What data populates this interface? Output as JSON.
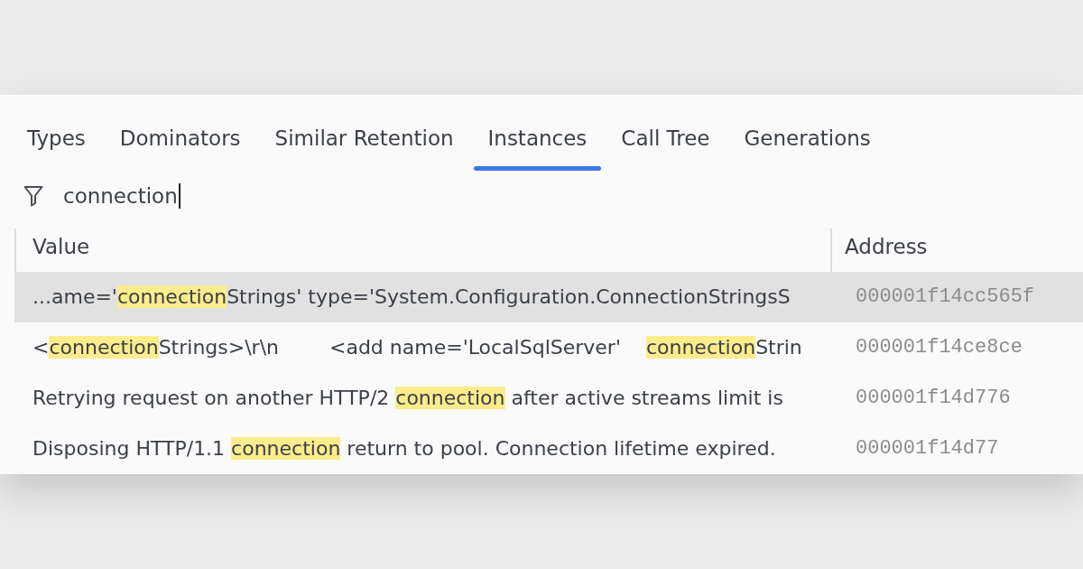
{
  "tabs": [
    {
      "label": "Types",
      "selected": false
    },
    {
      "label": "Dominators",
      "selected": false
    },
    {
      "label": "Similar Retention",
      "selected": false
    },
    {
      "label": "Instances",
      "selected": true
    },
    {
      "label": "Call Tree",
      "selected": false
    },
    {
      "label": "Generations",
      "selected": false
    }
  ],
  "filter": {
    "value": "connection"
  },
  "table": {
    "columns": [
      {
        "label": "Value"
      },
      {
        "label": "Address"
      }
    ],
    "rows": [
      {
        "selected": true,
        "value": [
          {
            "text": "...ame='",
            "kind": "plain"
          },
          {
            "text": "connection",
            "kind": "match"
          },
          {
            "text": "Strings' type='System.Configuration.ConnectionStringsS",
            "kind": "plain"
          }
        ],
        "address": "000001f14cc565f"
      },
      {
        "selected": false,
        "value": [
          {
            "text": "<",
            "kind": "plain"
          },
          {
            "text": "connection",
            "kind": "match"
          },
          {
            "text": "Strings>\\r\\n        <add name='LocalSqlServer'    ",
            "kind": "plain"
          },
          {
            "text": "connection",
            "kind": "match"
          },
          {
            "text": "Strin",
            "kind": "plain"
          }
        ],
        "address": "000001f14ce8ce"
      },
      {
        "selected": false,
        "value": [
          {
            "text": "Retrying request on another HTTP/2 ",
            "kind": "plain"
          },
          {
            "text": "connection",
            "kind": "match"
          },
          {
            "text": " after active streams limit is",
            "kind": "plain"
          }
        ],
        "address": "000001f14d776"
      },
      {
        "selected": false,
        "value": [
          {
            "text": "Disposing HTTP/1.1 ",
            "kind": "plain"
          },
          {
            "text": "connection",
            "kind": "match"
          },
          {
            "text": " return to pool. Connection lifetime expired.",
            "kind": "plain"
          }
        ],
        "address": "000001f14d77"
      }
    ]
  }
}
